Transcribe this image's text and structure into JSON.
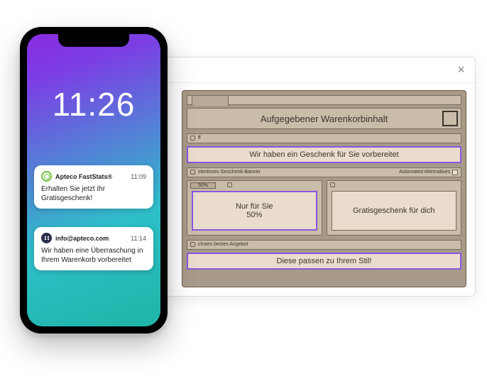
{
  "window": {
    "close_glyph": "×"
  },
  "builder": {
    "hero_title": "Aufgegebener Warenkorbinhalt",
    "strip1_left_suffix": "ff",
    "gift_banner": "Wir haben ein Geschenk für Sie vorbereitet",
    "strip2_left_label": "stenloses Geschenk-Banner",
    "strip2_right_label": "Automated Alternatives",
    "promo_left_pct": "50%",
    "promo_left_line1": "Nur für Sie",
    "promo_left_line2": "50%",
    "promo_right": "Gratisgeschenk für dich",
    "strip3_left_label": "chstes bestes Angebot",
    "style_banner": "Diese passen zu Ihrem Stil!"
  },
  "phone": {
    "clock": "11:26",
    "notifications": [
      {
        "app": "Apteco FastStats®",
        "time": "11:09",
        "body": "Erhalten Sie jetzt Ihr Gratisgeschenk!"
      },
      {
        "app": "info@apteco.com",
        "time": "11:14",
        "body": "Wir haben eine Überraschung in Ihrem Warenkorb vorbereitet"
      }
    ]
  }
}
